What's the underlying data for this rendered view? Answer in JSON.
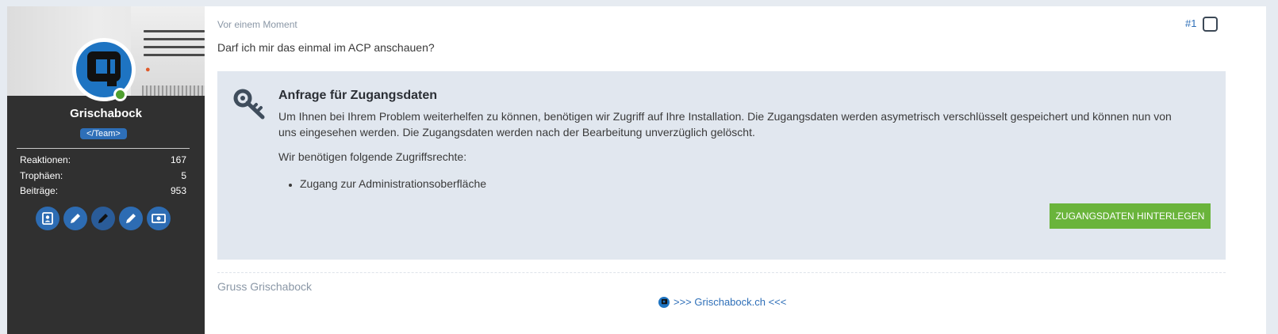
{
  "author": {
    "username": "Grischabock",
    "badge": "</Team>",
    "status": "online",
    "stats": [
      {
        "label": "Reaktionen:",
        "value": "167"
      },
      {
        "label": "Trophäen:",
        "value": "5"
      },
      {
        "label": "Beiträge:",
        "value": "953"
      }
    ],
    "actions": [
      {
        "name": "profile-button",
        "icon": "address-book-icon"
      },
      {
        "name": "edit-button-1",
        "icon": "pencil-icon"
      },
      {
        "name": "edit-button-2",
        "icon": "pencil-icon"
      },
      {
        "name": "edit-button-3",
        "icon": "pencil-icon"
      },
      {
        "name": "money-button",
        "icon": "money-bill-icon"
      }
    ]
  },
  "post": {
    "timestamp": "Vor einem Moment",
    "number": "#1",
    "question": "Darf ich mir das einmal im ACP anschauen?",
    "access_box": {
      "title": "Anfrage für Zugangsdaten",
      "text": "Um Ihnen bei Ihrem Problem weiterhelfen zu können, benötigen wir Zugriff auf Ihre Installation. Die Zugangsdaten werden asymetrisch verschlüsselt gespeichert und können nun von uns eingesehen werden. Die Zugangsdaten werden nach der Bearbeitung unverzüglich gelöscht.",
      "rights_label": "Wir benötigen folgende Zugriffsrechte:",
      "rights": [
        "Zugang zur Administrationsoberfläche"
      ],
      "button_label": "ZUGANGSDATEN HINTERLEGEN"
    },
    "signature": {
      "name": "Gruss Grischabock",
      "link_text": ">>> Grischabock.ch <<<"
    }
  },
  "colors": {
    "accent": "#2e6fb8",
    "button_green": "#6ab43b",
    "sidebar": "#303030",
    "box_bg": "#e1e7ef",
    "online": "#4f9f2f"
  }
}
